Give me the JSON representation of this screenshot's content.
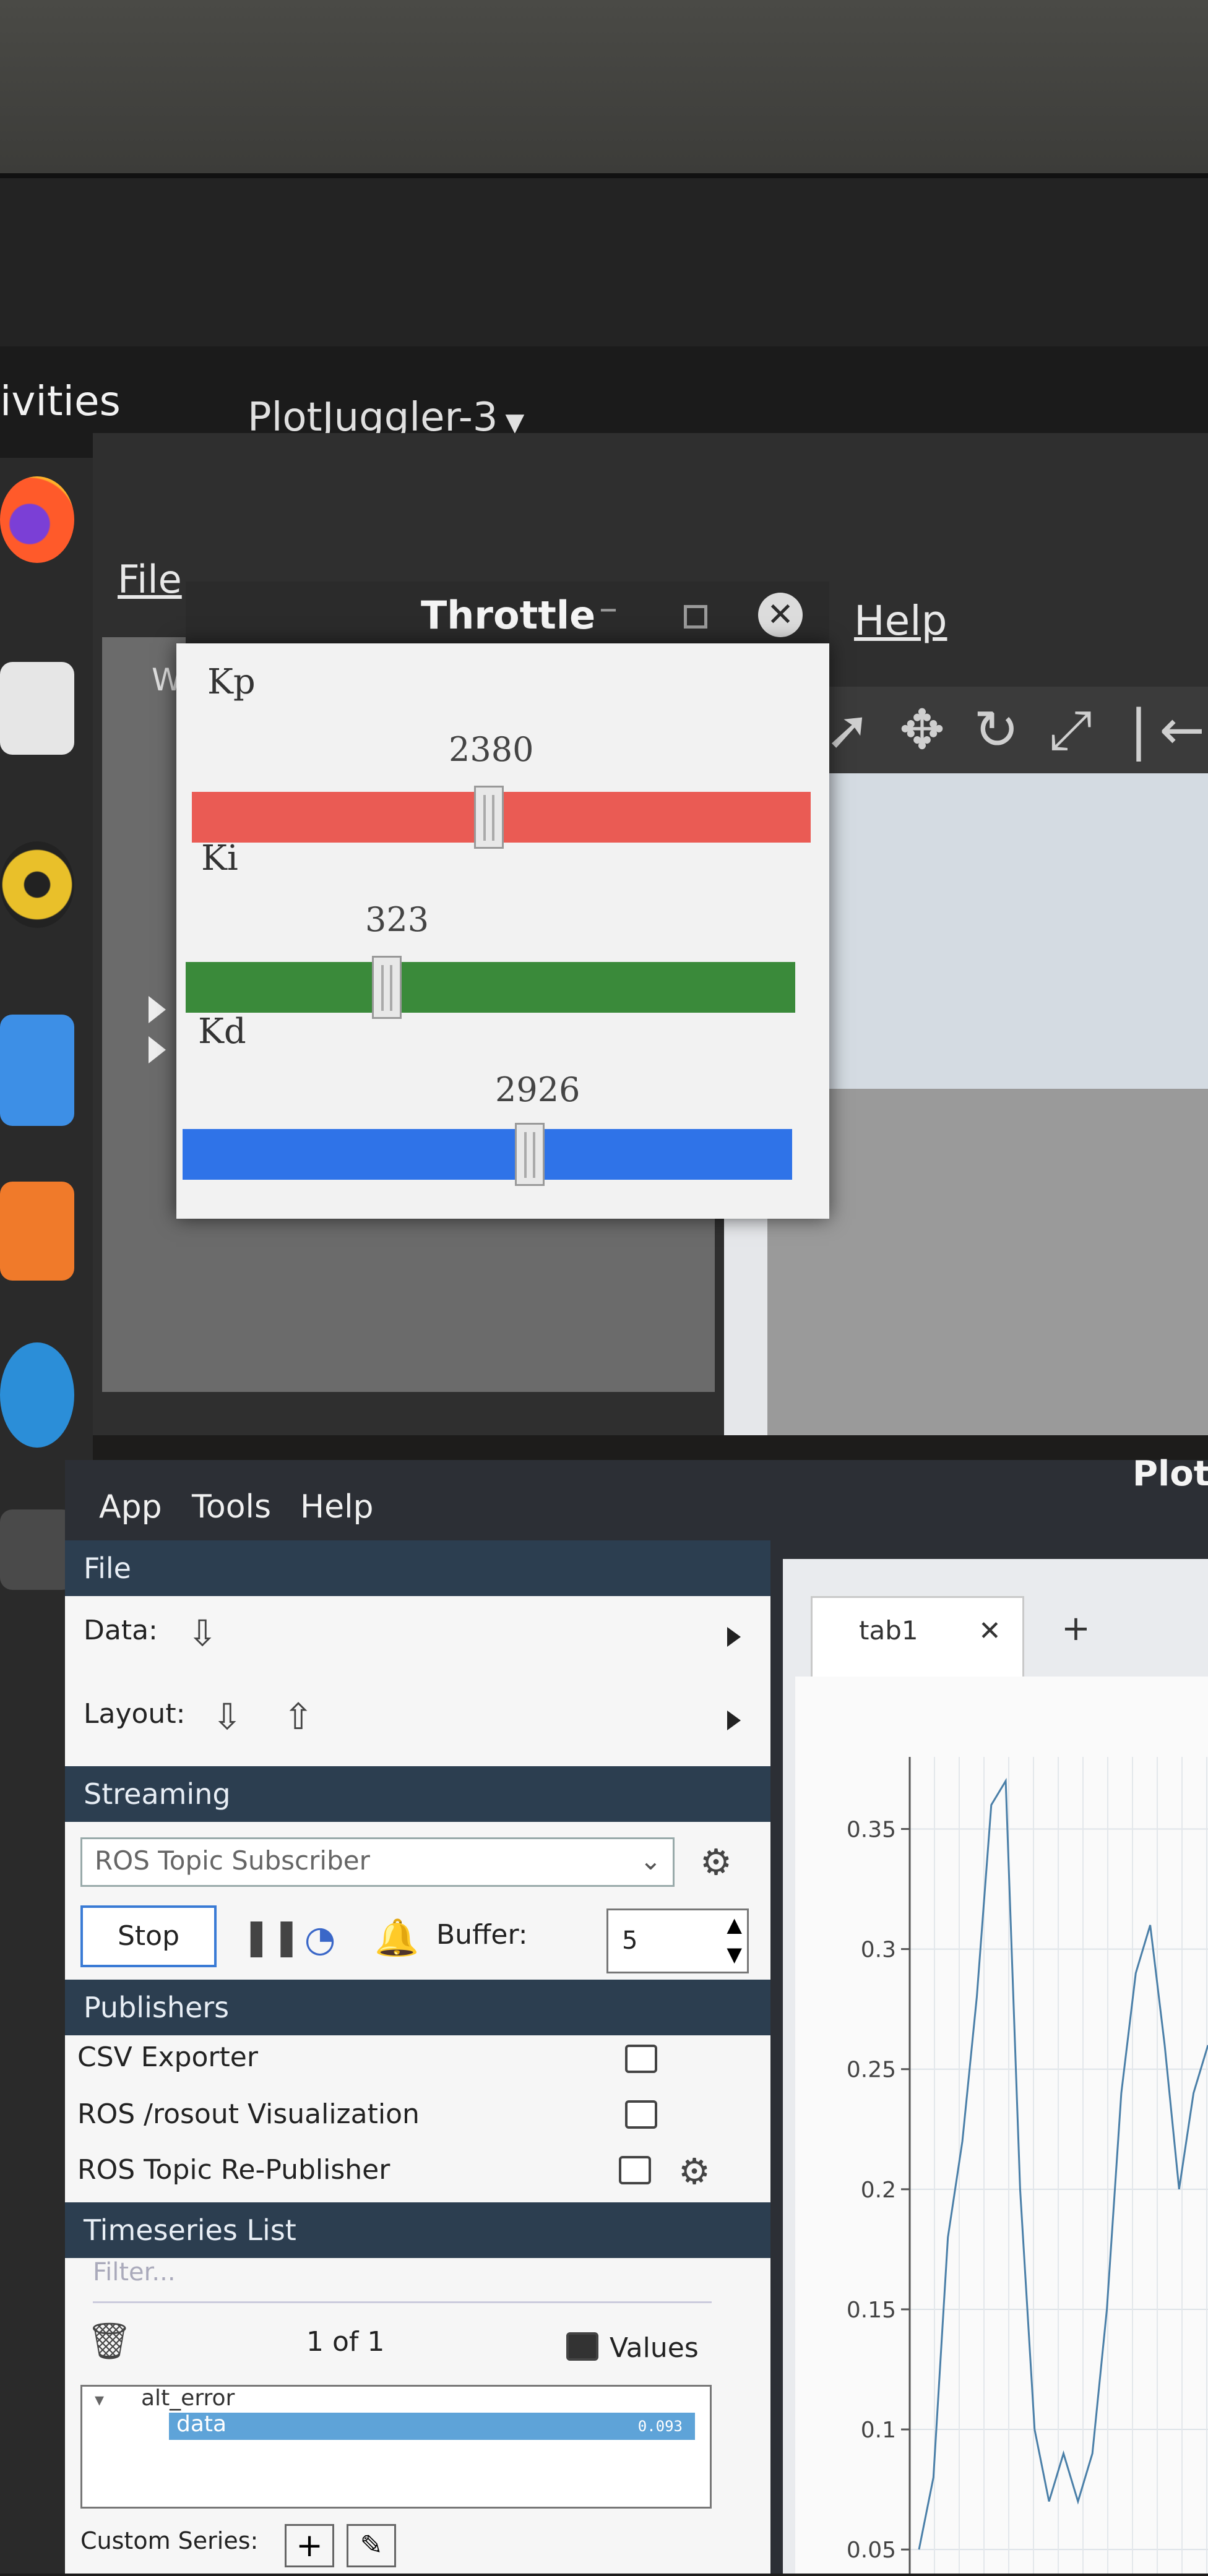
{
  "topbar": {
    "activities": "ivities",
    "app_name": "PlotJuggler-3"
  },
  "gnuplot_window": {
    "menu_file": "File",
    "menu_help": "Help",
    "left_letter": "W"
  },
  "throttle": {
    "title": "Throttle",
    "minimize": "–",
    "close": "✕",
    "params": [
      {
        "label": "Kp",
        "value": "2380",
        "fraction": 0.48,
        "color": "#ea5b54"
      },
      {
        "label": "Ki",
        "value": "323",
        "fraction": 0.33,
        "color": "#3a8a3a"
      },
      {
        "label": "Kd",
        "value": "2926",
        "fraction": 0.57,
        "color": "#2f73e8"
      }
    ]
  },
  "plotjuggler": {
    "title": "Plot",
    "menu": [
      "App",
      "Tools",
      "Help"
    ],
    "file_section": "File",
    "data_label": "Data:",
    "layout_label": "Layout:",
    "streaming_section": "Streaming",
    "streaming_source": "ROS Topic Subscriber",
    "stop_button": "Stop",
    "buffer_label": "Buffer:",
    "buffer_value": "5",
    "publishers_section": "Publishers",
    "publishers": [
      "CSV Exporter",
      "ROS /rosout Visualization",
      "ROS Topic Re-Publisher"
    ],
    "timeseries_section": "Timeseries List",
    "filter_placeholder": "Filter...",
    "page_count": "1 of 1",
    "values_label": "Values",
    "tree": {
      "parent": "alt_error",
      "child": "data",
      "child_value": "0.093"
    },
    "custom_series_label": "Custom Series:",
    "tab_label": "tab1",
    "tab_close": "✕",
    "tab_add": "+",
    "y_ticks": [
      "0.35",
      "0.3",
      "0.25",
      "0.2",
      "0.15",
      "0.1",
      "0.05"
    ]
  },
  "chart_data": {
    "type": "line",
    "ylim": [
      0.04,
      0.38
    ],
    "series": [
      {
        "values": [
          0.05,
          0.08,
          0.18,
          0.22,
          0.28,
          0.36,
          0.37,
          0.2,
          0.1,
          0.07,
          0.09,
          0.07,
          0.09,
          0.15,
          0.24,
          0.29,
          0.31,
          0.26,
          0.2,
          0.24,
          0.26
        ]
      }
    ]
  }
}
